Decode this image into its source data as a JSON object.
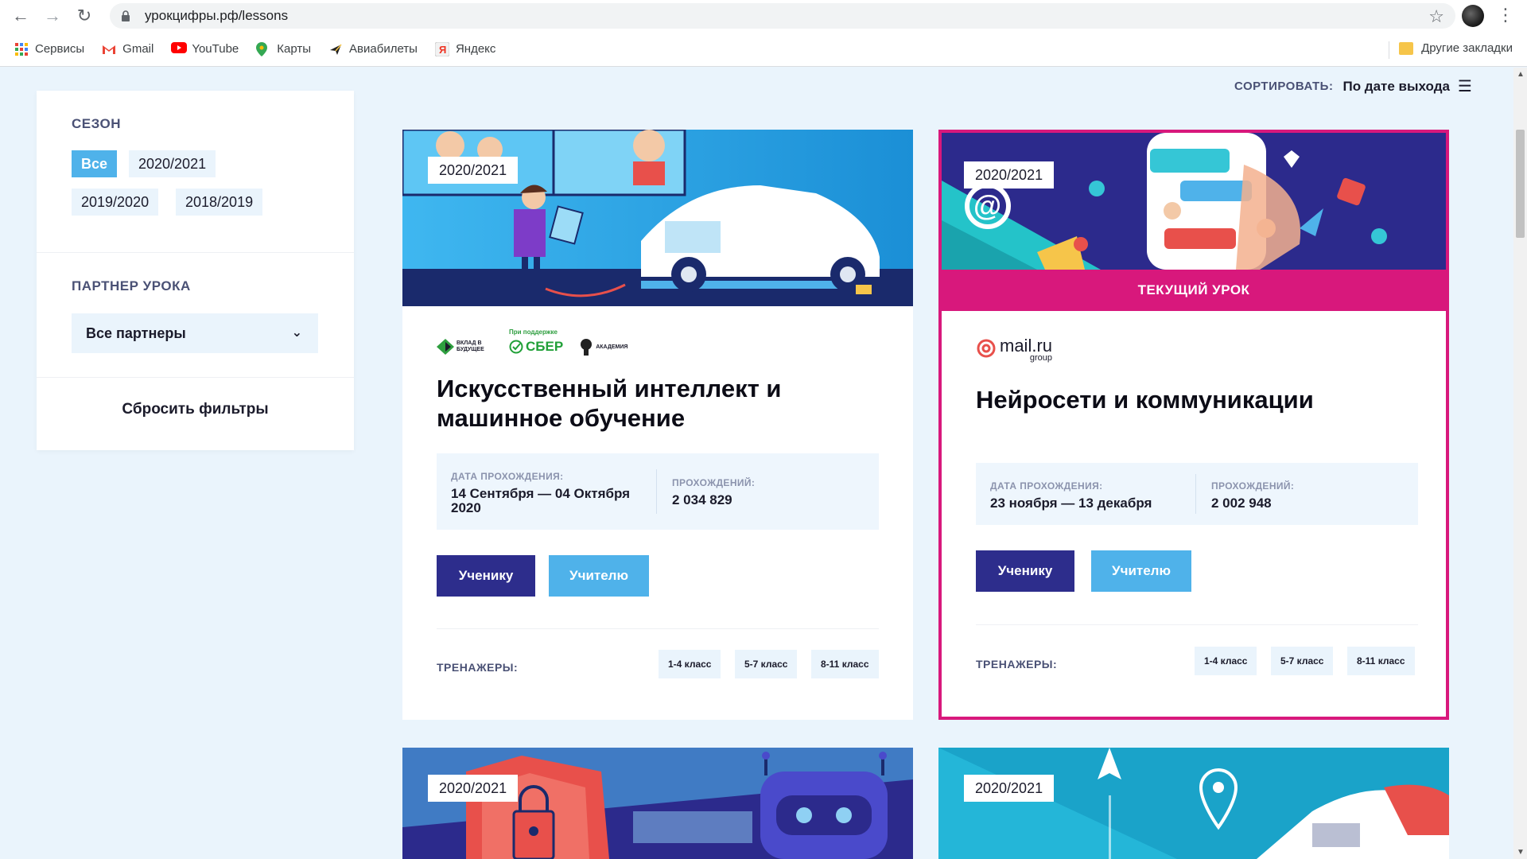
{
  "browser": {
    "url": "урокцифры.рф/lessons",
    "bookmarks": [
      "Сервисы",
      "Gmail",
      "YouTube",
      "Карты",
      "Авиабилеты",
      "Яндекс"
    ],
    "other_bookmarks": "Другие закладки"
  },
  "sidebar": {
    "season_title": "СЕЗОН",
    "seasons": [
      "Все",
      "2020/2021",
      "2019/2020",
      "2018/2019"
    ],
    "active_season": "Все",
    "partner_title": "ПАРТНЕР УРОКА",
    "partner_select": "Все партнеры",
    "reset_label": "Сбросить фильтры"
  },
  "sort": {
    "label": "СОРТИРОВАТЬ:",
    "value": "По дате выхода"
  },
  "lessons": [
    {
      "season": "2020/2021",
      "partners_caption": "При поддержке",
      "partner_logos": [
        "ВКЛАД В БУДУЩЕЕ",
        "СБЕР",
        "АКАДЕМИЯ"
      ],
      "title": "Искусственный интеллект и машинное обучение",
      "date_label": "ДАТА ПРОХОЖДЕНИЯ:",
      "date_value": "14 Сентября — 04 Октября 2020",
      "count_label": "ПРОХОЖДЕНИЙ:",
      "count_value": "2 034 829",
      "student_btn": "Ученику",
      "teacher_btn": "Учителю",
      "trainers_label": "ТРЕНАЖЕРЫ:",
      "grades": [
        "1-4 класс",
        "5-7 класс",
        "8-11 класс"
      ]
    },
    {
      "season": "2020/2021",
      "current_label": "ТЕКУЩИЙ УРОК",
      "partner_logo": "mail.ru",
      "partner_logo_sub": "group",
      "title": "Нейросети и коммуникации",
      "date_label": "ДАТА ПРОХОЖДЕНИЯ:",
      "date_value": "23 ноября — 13 декабря",
      "count_label": "ПРОХОЖДЕНИЙ:",
      "count_value": "2 002 948",
      "student_btn": "Ученику",
      "teacher_btn": "Учителю",
      "trainers_label": "ТРЕНАЖЕРЫ:",
      "grades": [
        "1-4 класс",
        "5-7 класс",
        "8-11 класс"
      ]
    },
    {
      "season": "2020/2021"
    },
    {
      "season": "2020/2021"
    }
  ]
}
